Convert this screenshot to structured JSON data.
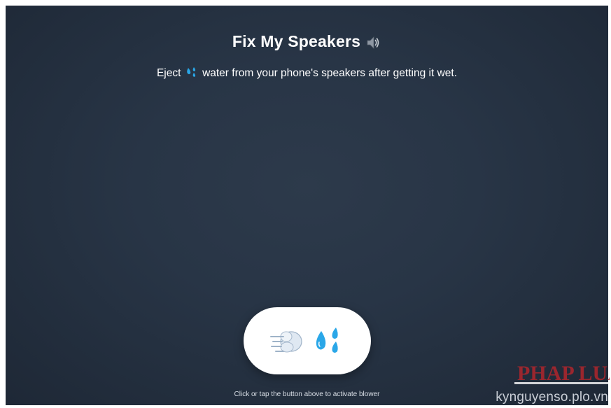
{
  "page": {
    "title": "Fix My Speakers",
    "title_icon": "speaker-loud-icon",
    "subtitle_before": "Eject",
    "subtitle_icon": "sweat-droplets-icon",
    "subtitle_after": "water from your phone's speakers after getting it wet.",
    "hint": "Click or tap the button above to activate blower"
  },
  "blower_button": {
    "icons": [
      "dashing-away-icon",
      "sweat-droplets-icon"
    ]
  },
  "watermark": {
    "logo": "PHAP LUAT",
    "text": "kynguyenso.plo.vn"
  },
  "colors": {
    "background": "#283546",
    "button": "#ffffff",
    "droplet": "#2aa7e8",
    "watermark_red": "#b0262c"
  }
}
